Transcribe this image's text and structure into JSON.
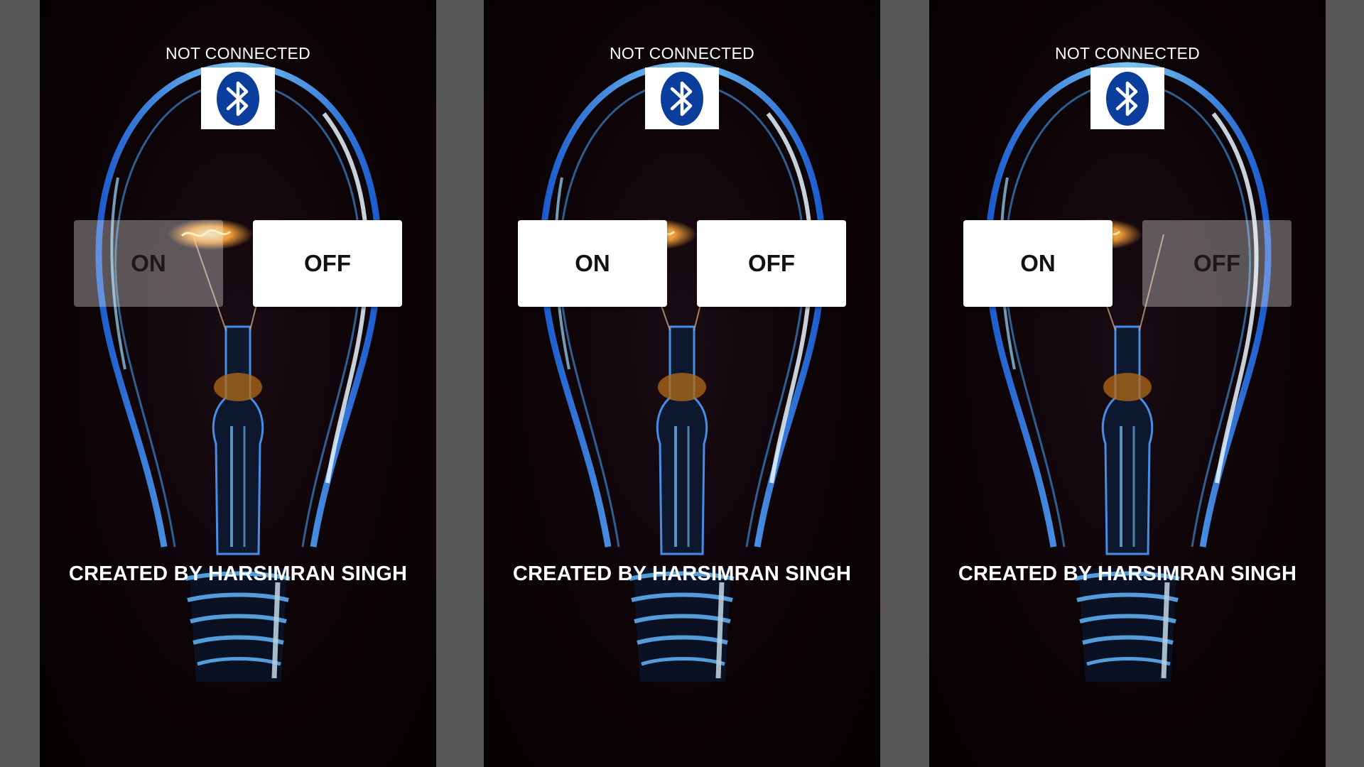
{
  "screens": [
    {
      "status": "NOT CONNECTED",
      "on_label": "ON",
      "off_label": "OFF",
      "on_state": "faded",
      "off_state": "active",
      "credit": "CREATED BY HARSIMRAN SINGH"
    },
    {
      "status": "NOT CONNECTED",
      "on_label": "ON",
      "off_label": "OFF",
      "on_state": "active",
      "off_state": "active",
      "credit": "CREATED BY HARSIMRAN SINGH"
    },
    {
      "status": "NOT CONNECTED",
      "on_label": "ON",
      "off_label": "OFF",
      "on_state": "active",
      "off_state": "faded",
      "credit": "CREATED BY HARSIMRAN SINGH"
    }
  ],
  "icons": {
    "bluetooth": "bluetooth-icon"
  },
  "colors": {
    "background": "#585858",
    "bluetooth_blue": "#0a3d9c",
    "filament_blue": "#3fa9ff",
    "filament_glow": "#ffb347"
  }
}
